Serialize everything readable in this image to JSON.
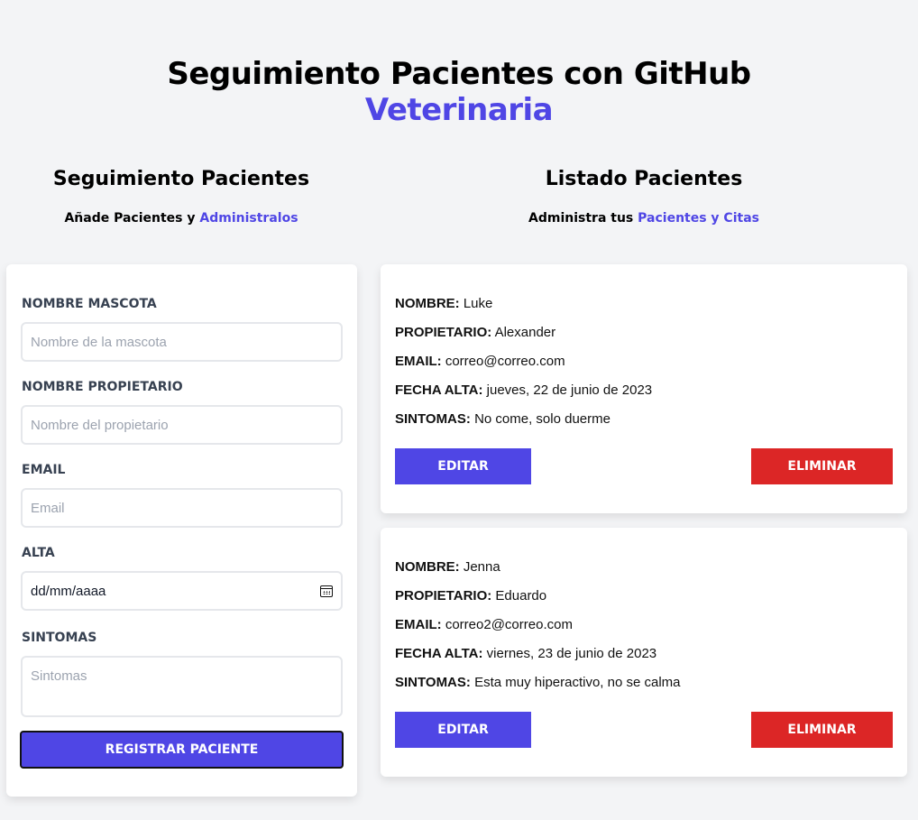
{
  "header": {
    "title": "Seguimiento Pacientes con GitHub",
    "title_accent": "Veterinaria"
  },
  "form_section": {
    "heading": "Seguimiento Pacientes",
    "subtitle_prefix": "Añade Pacientes y",
    "subtitle_accent": "Administralos"
  },
  "list_section": {
    "heading": "Listado Pacientes",
    "subtitle_prefix": "Administra tus",
    "subtitle_accent": "Pacientes y Citas"
  },
  "form": {
    "pet_label": "NOMBRE MASCOTA",
    "pet_placeholder": "Nombre de la mascota",
    "owner_label": "NOMBRE PROPIETARIO",
    "owner_placeholder": "Nombre del propietario",
    "email_label": "EMAIL",
    "email_placeholder": "Email",
    "date_label": "ALTA",
    "date_value": "dd/mm/aaaa",
    "symptoms_label": "SINTOMAS",
    "symptoms_placeholder": "Sintomas",
    "submit_label": "REGISTRAR PACIENTE"
  },
  "labels": {
    "name": "NOMBRE:",
    "owner": "PROPIETARIO:",
    "email": "EMAIL:",
    "date": "FECHA ALTA:",
    "symptoms": "SINTOMAS:",
    "edit": "EDITAR",
    "delete": "ELIMINAR"
  },
  "patients": [
    {
      "name": "Luke",
      "owner": "Alexander",
      "email": "correo@correo.com",
      "date": "jueves, 22 de junio de 2023",
      "symptoms": "No come, solo duerme"
    },
    {
      "name": "Jenna",
      "owner": "Eduardo",
      "email": "correo2@correo.com",
      "date": "viernes, 23 de junio de 2023",
      "symptoms": "Esta muy hiperactivo, no se calma"
    }
  ],
  "colors": {
    "accent": "#4f46e5",
    "danger": "#dc2626",
    "background": "#f3f4f6"
  }
}
